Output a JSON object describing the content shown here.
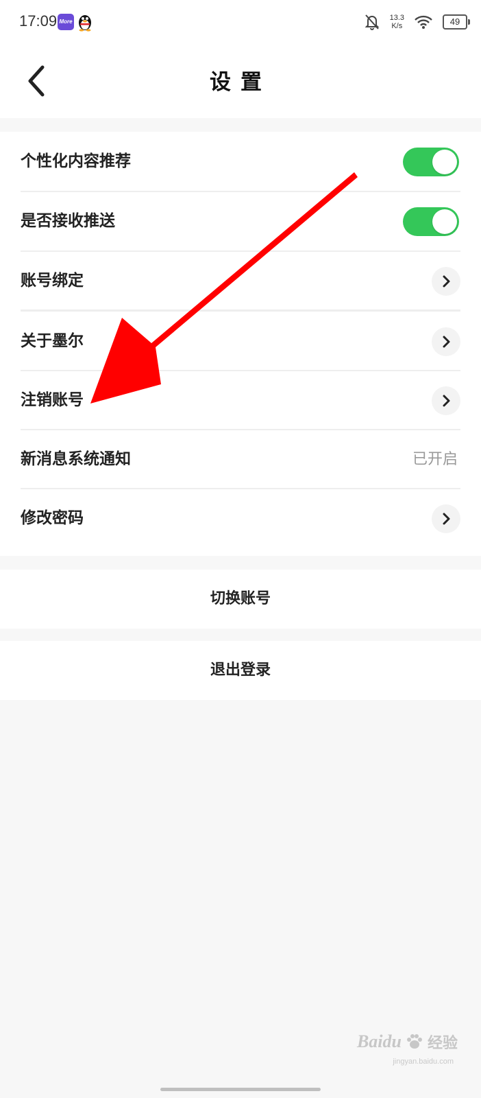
{
  "status_bar": {
    "time": "17:09",
    "app_icon_text": "More",
    "speed_value": "13.3",
    "speed_unit": "K/s",
    "battery": "49",
    "icons": [
      "more-app-icon",
      "qq-penguin-icon",
      "bell-muted-icon",
      "wifi-icon",
      "battery-icon"
    ]
  },
  "header": {
    "title": "设置",
    "back_icon": "chevron-left-icon"
  },
  "settings": [
    {
      "label": "个性化内容推荐",
      "control": "toggle",
      "on": true
    },
    {
      "label": "是否接收推送",
      "control": "toggle",
      "on": true
    },
    {
      "label": "账号绑定",
      "control": "chevron"
    },
    {
      "label": "关于墨尔",
      "control": "chevron"
    },
    {
      "label": "注销账号",
      "control": "chevron"
    },
    {
      "label": "新消息系统通知",
      "control": "value",
      "value": "已开启"
    },
    {
      "label": "修改密码",
      "control": "chevron"
    }
  ],
  "actions": {
    "switch_account": "切换账号",
    "logout": "退出登录"
  },
  "colors": {
    "toggle_on": "#34c759",
    "annotation_arrow": "#ff0000"
  },
  "watermark": {
    "brand": "Baidu",
    "brand_cn": "经验",
    "url": "jingyan.baidu.com"
  }
}
